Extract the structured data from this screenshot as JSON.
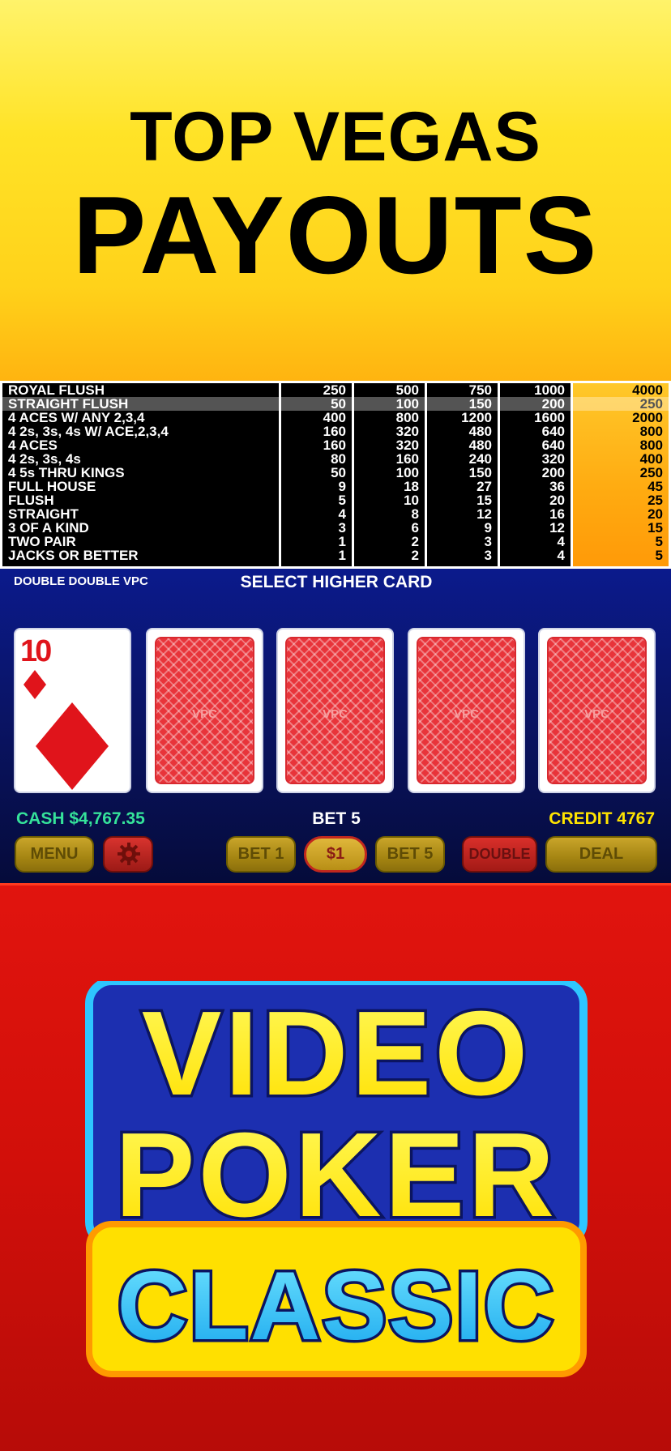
{
  "hero": {
    "line1": "TOP VEGAS",
    "line2": "PAYOUTS"
  },
  "paytable": {
    "hands": [
      "ROYAL FLUSH",
      "STRAIGHT FLUSH",
      "4 ACES W/ ANY 2,3,4",
      "4 2s, 3s, 4s W/ ACE,2,3,4",
      "4 ACES",
      "4 2s, 3s, 4s",
      "4 5s THRU KINGS",
      "FULL HOUSE",
      "FLUSH",
      "STRAIGHT",
      "3 OF A KIND",
      "TWO PAIR",
      "JACKS OR BETTER"
    ],
    "columns": [
      [
        "250",
        "50",
        "400",
        "160",
        "160",
        "80",
        "50",
        "9",
        "5",
        "4",
        "3",
        "1",
        "1"
      ],
      [
        "500",
        "100",
        "800",
        "320",
        "320",
        "160",
        "100",
        "18",
        "10",
        "8",
        "6",
        "2",
        "2"
      ],
      [
        "750",
        "150",
        "1200",
        "480",
        "480",
        "240",
        "150",
        "27",
        "15",
        "12",
        "9",
        "3",
        "3"
      ],
      [
        "1000",
        "200",
        "1600",
        "640",
        "640",
        "320",
        "200",
        "36",
        "20",
        "16",
        "12",
        "4",
        "4"
      ],
      [
        "4000",
        "250",
        "2000",
        "800",
        "800",
        "400",
        "250",
        "45",
        "25",
        "20",
        "15",
        "5",
        "5"
      ]
    ],
    "highlighted_row": "STRAIGHT FLUSH",
    "active_column_color": "#ffaa10"
  },
  "game": {
    "game_name": "DOUBLE DOUBLE VPC",
    "message": "SELECT HIGHER CARD",
    "dealer_card": {
      "rank": "10",
      "suit": "diamond-icon"
    },
    "card_back_logo": "VPC",
    "cash": "CASH $4,767.35",
    "bet": "BET 5",
    "credit": "CREDIT 4767",
    "buttons": {
      "menu": "MENU",
      "bet1": "BET 1",
      "denom": "$1",
      "bet5": "BET 5",
      "double": "DOUBLE",
      "deal": "DEAL"
    },
    "icons": {
      "settings": "gear-icon"
    }
  },
  "logo": {
    "line1": "VIDEO",
    "line2": "POKER",
    "line3": "CLASSIC"
  },
  "colors": {
    "hero_yellow": "#ffe327",
    "game_blue": "#0a1466",
    "logo_red": "#d10f0a",
    "cash_green": "#35e29a",
    "credit_yellow": "#ffe400"
  }
}
